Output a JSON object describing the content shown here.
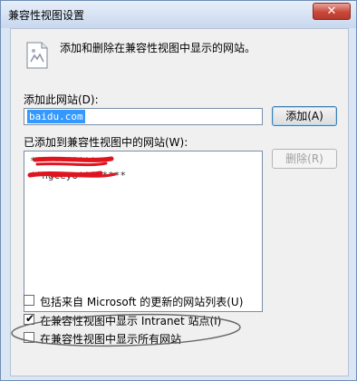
{
  "window": {
    "title": "兼容性视图设置",
    "close_glyph": "✕"
  },
  "description": "添加和删除在兼容性视图中显示的网站。",
  "add_site": {
    "label": "添加此网站(D):",
    "value": "baidu.com",
    "button_label": "添加(A)"
  },
  "added_sites": {
    "label": "已添加到兼容性视图中的网站(W):",
    "items": [
      "***********",
      "**ngceyo********"
    ],
    "remove_button_label": "删除(R)",
    "remove_enabled": false
  },
  "options": [
    {
      "label": "包括来自 Microsoft 的更新的网站列表(U)",
      "checked": false
    },
    {
      "label": "在兼容性视图中显示 Intranet 站点(I)",
      "checked": true
    },
    {
      "label": "在兼容性视图中显示所有网站",
      "checked": false
    }
  ],
  "annotation_colors": {
    "scribble": "#e0141e",
    "ellipse": "#6a6a6a"
  }
}
